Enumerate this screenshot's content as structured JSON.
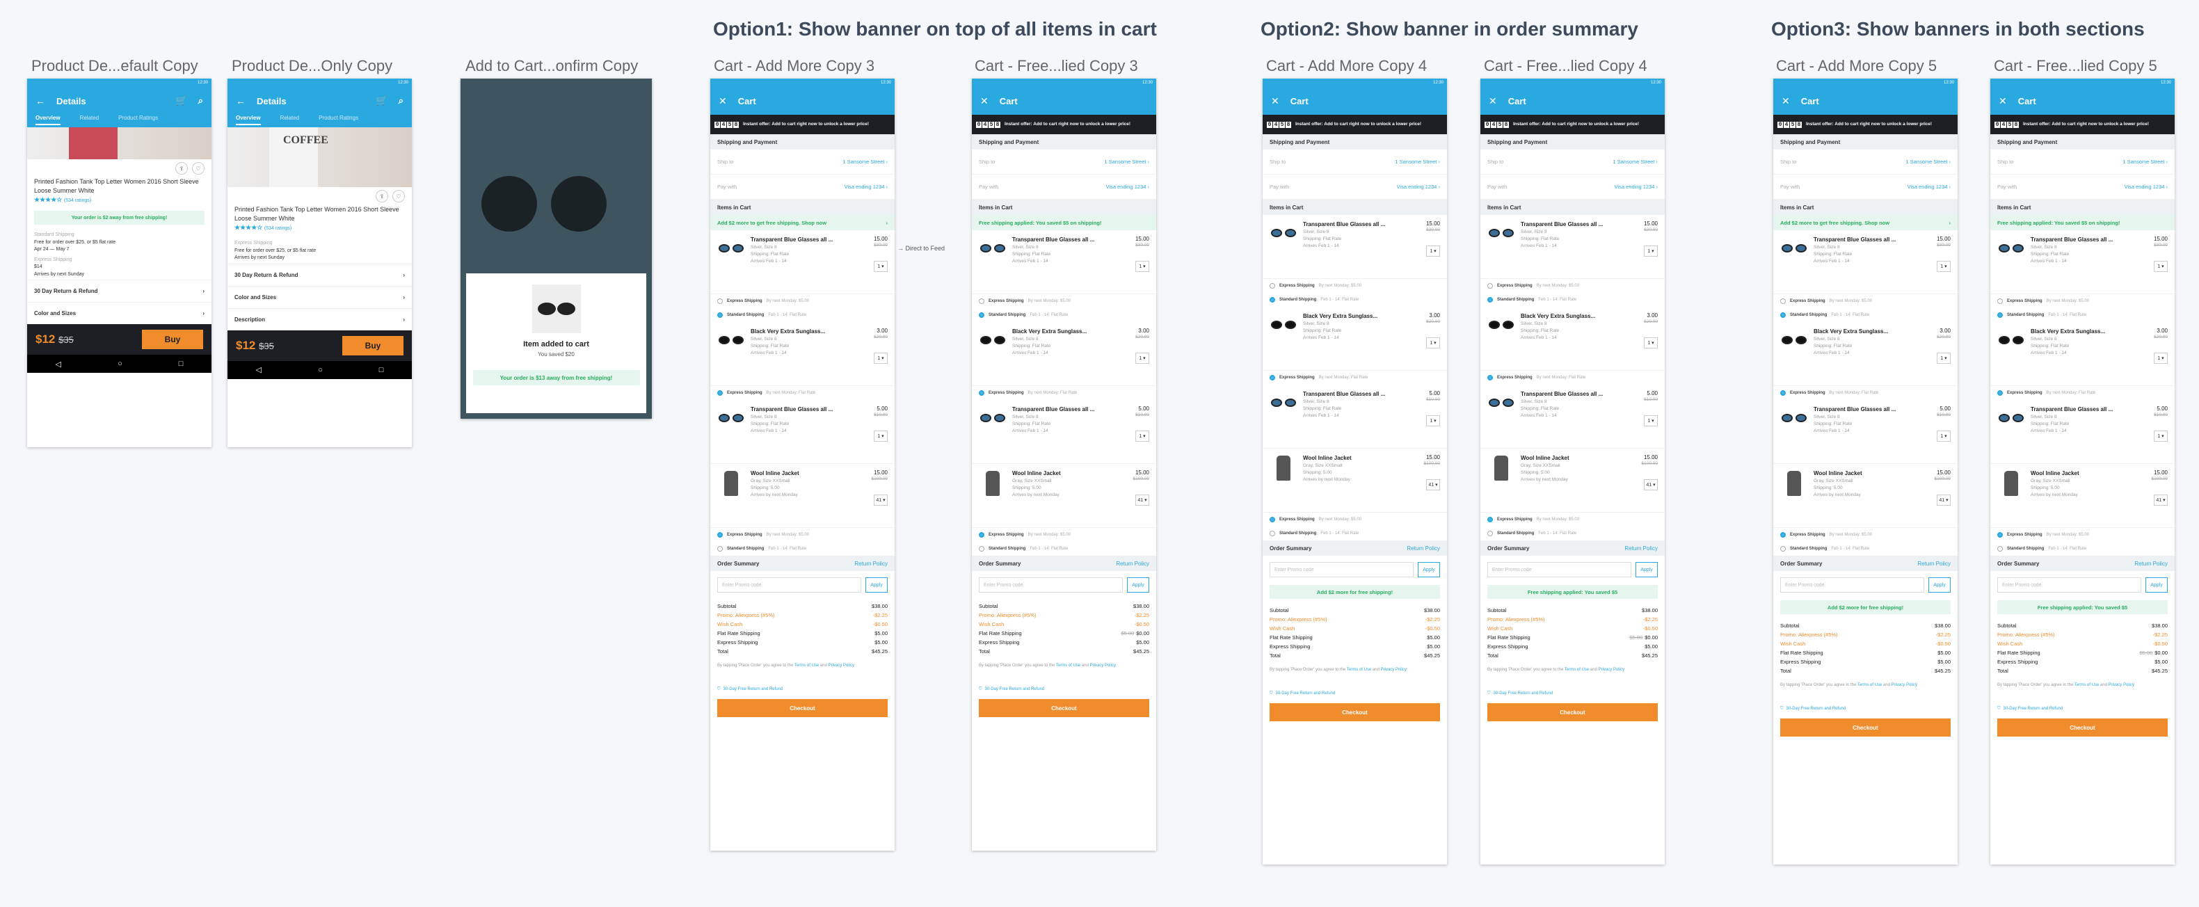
{
  "sections": [
    "Option1: Show banner on top of all items in cart",
    "Option2: Show banner in order summary",
    "Option3: Show banners in both sections"
  ],
  "labels": [
    "Product De...efault Copy",
    "Product De...Only Copy",
    "Add to Cart...onfirm Copy",
    "Cart - Add More Copy 3",
    "Cart - Free...lied Copy 3",
    "Cart - Add More Copy 4",
    "Cart - Free...lied Copy 4",
    "Cart - Add More Copy 5",
    "Cart - Free...lied Copy 5"
  ],
  "status_time": "12:30",
  "detail": {
    "title": "Details",
    "tabs": [
      "Overview",
      "Related",
      "Product Ratings"
    ],
    "product_title": "Printed Fashion Tank Top Letter Women 2016 Short Sleeve Loose Summer White",
    "stars": "★★★★☆",
    "ratings": "(534 ratings)",
    "free_banner": "Your order is $2 away from free shipping!",
    "std_label": "Standard Shipping",
    "std_line1": "Free for order over $25, or $5 flat rate",
    "std_line2": "Apr 24 — May 7",
    "exp_label": "Express Shipping",
    "exp_price": "$14",
    "exp_arrive": "Arrives by next Sunday",
    "rows": [
      "30 Day Return & Refund",
      "Color and Sizes",
      "Description"
    ],
    "price": "$12",
    "old_price": "$35",
    "buy": "Buy",
    "hero_text": "COFFEE"
  },
  "confirm": {
    "title": "Item added to cart",
    "saved": "You saved $20",
    "banner": "Your order is $13 away from free shipping!"
  },
  "cart": {
    "title": "Cart",
    "timer": [
      "0",
      "4",
      "5",
      "8"
    ],
    "timer_msg": "Instant offer: Add to cart right now to unlock a lower price!",
    "shipping_header": "Shipping and Payment",
    "ship_to": "Ship to",
    "ship_to_val": "1 Sansome Street",
    "pay_with": "Pay with",
    "pay_with_val": "Visa ending 1234",
    "items_header": "Items in Cart",
    "add_more_banner": "Add $2 more to get free shipping. Shop now",
    "free_banner": "Free shipping applied: You saved $5 on shipping!",
    "add_more_short": "Add $2 more for free shipping!",
    "free_short": "Free shipping applied: You saved $5",
    "direct": "Direct to Feed",
    "items": [
      {
        "name": "Transparent Blue Glasses all ...",
        "color": "Silver, Size 8",
        "ship": "Shipping: Flat Rate",
        "arrive": "Arrives Feb 1 - 14",
        "price": "15.00",
        "old": "$30.00",
        "qty": "1"
      },
      {
        "name": "Black Very Extra Sunglass...",
        "color": "Silver, Size 8",
        "ship": "Shipping: Flat Rate",
        "arrive": "Arrives Feb 1 - 14",
        "price": "3.00",
        "old": "$20.00",
        "qty": "1"
      },
      {
        "name": "Transparent Blue Glasses all ...",
        "color": "Silver, Size 8",
        "ship": "Shipping: Flat Rate",
        "arrive": "Arrives Feb 1 - 14",
        "price": "5.00",
        "old": "$10.00",
        "qty": "1"
      },
      {
        "name": "Wool Inline Jacket",
        "color": "Gray, Size XXSmall",
        "ship": "Shipping: 5.00",
        "arrive": "Arrives by next Monday",
        "price": "15.00",
        "old": "$100.00",
        "qty": "41"
      }
    ],
    "express": "Express Shipping",
    "express_note": "By next Monday: $5.00",
    "express_flat": "By next Monday: Flat Rate",
    "standard": "Standard Shipping",
    "standard_note": "Feb 1 - 14: Flat Rate",
    "order_summary": "Order Summary",
    "return_policy": "Return Policy",
    "promo_placeholder": "Enter Promo code",
    "apply": "Apply",
    "subtotal": "Subtotal",
    "subtotal_v": "$38.00",
    "promo": "Promo: Aliexpress (#5%)",
    "promo_v": "-$2.25",
    "wish": "Wish Cash",
    "wish_v": "-$0.50",
    "flat": "Flat Rate Shipping",
    "flat_v": "$5.00",
    "flat_old": "$5.00",
    "flat_free": "$0.00",
    "exp": "Express Shipping",
    "exp_v": "$5.00",
    "total": "Total",
    "total_v": "$45.25",
    "agree_a": "By tapping 'Place Order' you agree to the ",
    "terms": "Terms of Use",
    "and": " and ",
    "privacy": "Privacy Policy",
    "return_note": "30-Day Free Return and Refund",
    "checkout": "Checkout"
  }
}
